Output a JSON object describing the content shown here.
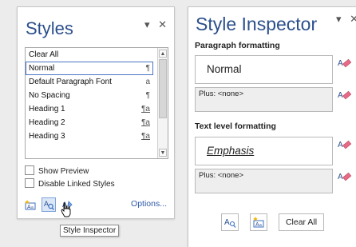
{
  "styles_pane": {
    "title": "Styles",
    "controls": {
      "menu_glyph": "▾",
      "close_glyph": "✕"
    },
    "items": [
      {
        "label": "Clear All",
        "mark": ""
      },
      {
        "label": "Normal",
        "mark": "¶"
      },
      {
        "label": "Default Paragraph Font",
        "mark": "a"
      },
      {
        "label": "No Spacing",
        "mark": "¶"
      },
      {
        "label": "Heading 1",
        "mark": "¶a"
      },
      {
        "label": "Heading 2",
        "mark": "¶a"
      },
      {
        "label": "Heading 3",
        "mark": "¶a"
      }
    ],
    "selected_item": "Normal",
    "show_preview": {
      "label": "Show Preview",
      "checked": false
    },
    "disable_linked": {
      "label": "Disable Linked Styles",
      "checked": false
    },
    "buttons": {
      "new_style": "new-style-icon",
      "style_inspector": "style-inspector-icon",
      "manage_styles": "manage-styles-icon"
    },
    "options_label": "Options...",
    "tooltip": "Style Inspector"
  },
  "inspector_pane": {
    "title": "Style Inspector",
    "controls": {
      "menu_glyph": "▾",
      "close_glyph": "✕"
    },
    "paragraph_heading": "Paragraph formatting",
    "paragraph_style": "Normal",
    "paragraph_plus": "Plus: <none>",
    "text_heading": "Text level formatting",
    "text_style": "Emphasis",
    "text_plus": "Plus: <none>",
    "clear_all_label": "Clear All",
    "colors": {
      "title": "#2b4f8c",
      "eraser_pink": "#e86a86",
      "link": "#2d58a8"
    }
  }
}
